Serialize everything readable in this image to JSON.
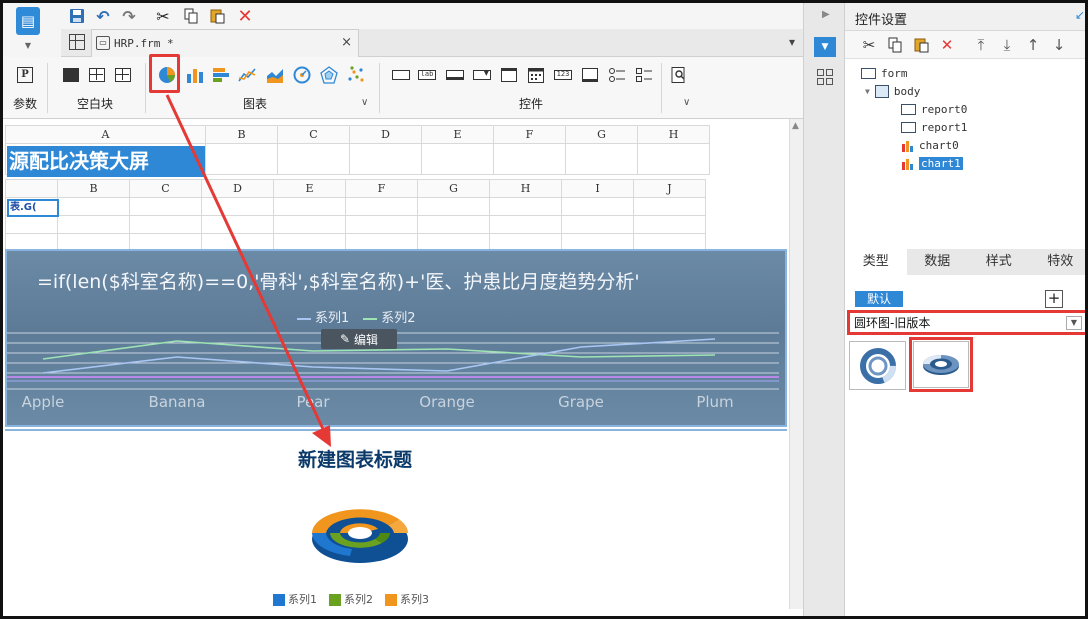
{
  "quickbar": {
    "icons": [
      "save-icon",
      "undo-icon",
      "redo-icon",
      "cut-icon",
      "copy-icon",
      "paste-icon",
      "delete-icon"
    ]
  },
  "tab": {
    "filename": "HRP.frm *",
    "close_glyph": "×"
  },
  "ribbon": {
    "param_label": "参数",
    "blank_block_label": "空白块",
    "chart_label": "图表",
    "control_label": "控件",
    "param_icon_glyph": "P",
    "text_icon_glyph": "lab",
    "number_icon_glyph": "123"
  },
  "sheet": {
    "grid1_columns": [
      "A",
      "B",
      "C",
      "D",
      "E",
      "F",
      "G",
      "H"
    ],
    "grid1_title": "源配比决策大屏",
    "grid2_columns": [
      "B",
      "C",
      "D",
      "E",
      "F",
      "G",
      "H",
      "I",
      "J"
    ],
    "grid2_cell": "表.G("
  },
  "chart0": {
    "formula": "=if(len($科室名称)==0,'骨科',$科室名称)+'医、护患比月度趋势分析'",
    "legend": [
      {
        "name": "系列1",
        "color": "#a9c6f2"
      },
      {
        "name": "系列2",
        "color": "#9ee3b3"
      }
    ],
    "edit_label": "编辑",
    "categories": [
      "Apple",
      "Banana",
      "Pear",
      "Orange",
      "Grape",
      "Plum"
    ]
  },
  "chart1": {
    "title": "新建图表标题",
    "legend": [
      {
        "name": "系列1",
        "color": "#1f77d0"
      },
      {
        "name": "系列2",
        "color": "#6aa120"
      },
      {
        "name": "系列3",
        "color": "#f0961e"
      }
    ]
  },
  "panel": {
    "title": "控件设置",
    "tree": [
      {
        "label": "form",
        "icon": "form-icon"
      },
      {
        "label": "body",
        "icon": "body-icon"
      },
      {
        "label": "report0",
        "icon": "report-icon"
      },
      {
        "label": "report1",
        "icon": "report-icon"
      },
      {
        "label": "chart0",
        "icon": "chart-icon"
      },
      {
        "label": "chart1",
        "icon": "chart-icon",
        "selected": true
      }
    ],
    "tabs": [
      "类型",
      "数据",
      "样式",
      "特效"
    ],
    "default_label": "默认",
    "add_glyph": "+",
    "chart_type_selected": "圆环图-旧版本"
  },
  "colors": {
    "accent": "#2f88d6",
    "highlight": "#e53935"
  }
}
